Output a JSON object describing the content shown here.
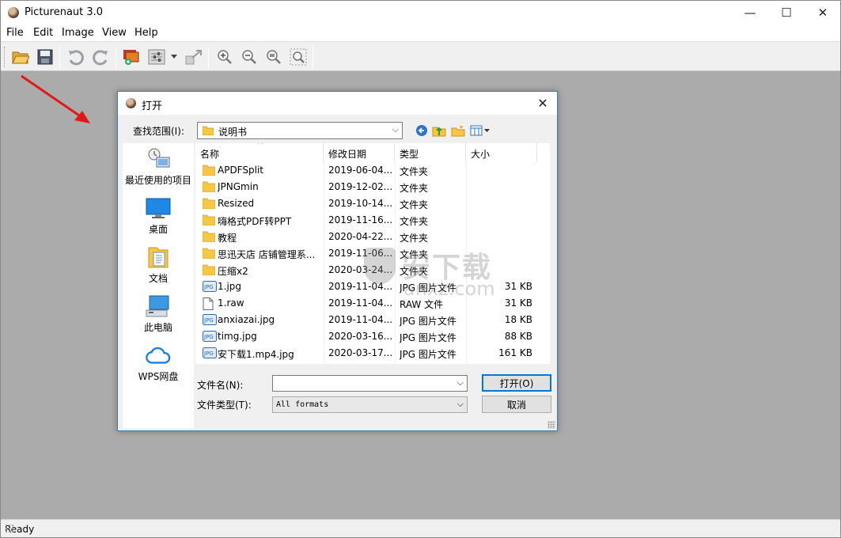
{
  "app": {
    "title": "Picturenaut 3.0",
    "window_controls": {
      "minimize": "—",
      "maximize": "☐",
      "close": "✕"
    }
  },
  "menu": [
    "File",
    "Edit",
    "Image",
    "View",
    "Help"
  ],
  "toolbar": {
    "icons": [
      "open-folder-icon",
      "save-icon",
      "undo-icon",
      "redo-icon",
      "generate-hdr-icon",
      "adjust-icon",
      "dropdown-icon",
      "resize-icon",
      "zoom-in-icon",
      "zoom-out-icon",
      "zoom-reset-icon",
      "zoom-fit-icon"
    ]
  },
  "status": {
    "text": "Ready"
  },
  "dialog": {
    "title": "打开",
    "look_in_label": "查找范围(I):",
    "look_in_value": "说明书",
    "places": [
      {
        "label": "最近使用的项目",
        "icon": "recent-items-icon"
      },
      {
        "label": "桌面",
        "icon": "desktop-icon"
      },
      {
        "label": "文档",
        "icon": "documents-icon"
      },
      {
        "label": "此电脑",
        "icon": "this-pc-icon"
      },
      {
        "label": "WPS网盘",
        "icon": "cloud-icon"
      }
    ],
    "columns": {
      "name": "名称",
      "date": "修改日期",
      "type": "类型",
      "size": "大小"
    },
    "files": [
      {
        "name": "APDFSplit",
        "date": "2019-06-04...",
        "type": "文件夹",
        "size": "",
        "icon": "folder"
      },
      {
        "name": "JPNGmin",
        "date": "2019-12-02...",
        "type": "文件夹",
        "size": "",
        "icon": "folder"
      },
      {
        "name": "Resized",
        "date": "2019-10-14...",
        "type": "文件夹",
        "size": "",
        "icon": "folder"
      },
      {
        "name": "嗨格式PDF转PPT",
        "date": "2019-11-16...",
        "type": "文件夹",
        "size": "",
        "icon": "folder"
      },
      {
        "name": "教程",
        "date": "2020-04-22...",
        "type": "文件夹",
        "size": "",
        "icon": "folder"
      },
      {
        "name": "思迅天店 店铺管理系...",
        "date": "2019-11-06...",
        "type": "文件夹",
        "size": "",
        "icon": "folder"
      },
      {
        "name": "压缩x2",
        "date": "2020-03-24...",
        "type": "文件夹",
        "size": "",
        "icon": "folder"
      },
      {
        "name": "1.jpg",
        "date": "2019-11-04...",
        "type": "JPG 图片文件",
        "size": "31 KB",
        "icon": "jpg"
      },
      {
        "name": "1.raw",
        "date": "2019-11-04...",
        "type": "RAW 文件",
        "size": "31 KB",
        "icon": "file"
      },
      {
        "name": "anxiazai.jpg",
        "date": "2019-11-04...",
        "type": "JPG 图片文件",
        "size": "18 KB",
        "icon": "jpg"
      },
      {
        "name": "timg.jpg",
        "date": "2020-03-16...",
        "type": "JPG 图片文件",
        "size": "88 KB",
        "icon": "jpg"
      },
      {
        "name": "安下载1.mp4.jpg",
        "date": "2020-03-17...",
        "type": "JPG 图片文件",
        "size": "161 KB",
        "icon": "jpg"
      }
    ],
    "filename_label": "文件名(N):",
    "filename_value": "",
    "filetype_label": "文件类型(T):",
    "filetype_value": "All formats",
    "open_button": "打开(O)",
    "cancel_button": "取消"
  },
  "watermark": {
    "line1": "安下载",
    "line2": "anxz.com"
  },
  "colors": {
    "workspace": "#ababab",
    "dialog_border": "#3c7fb1",
    "folder": "#f5c745",
    "default_button_border": "#0078d7"
  }
}
